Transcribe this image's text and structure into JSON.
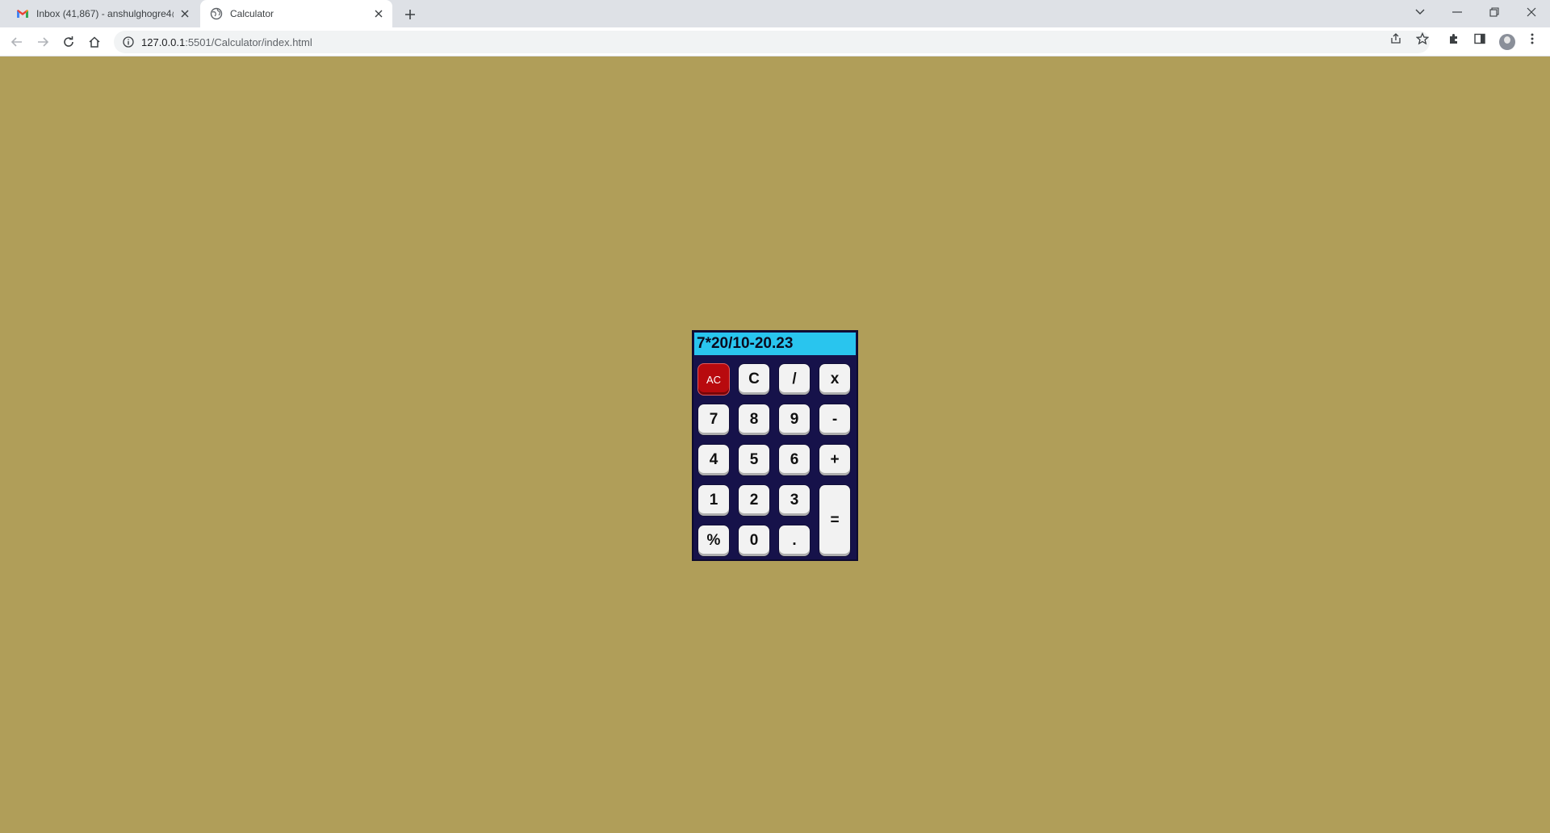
{
  "browser": {
    "tabs": [
      {
        "title": "Inbox (41,867) - anshulghogre4@",
        "icon": "gmail-icon",
        "active": false
      },
      {
        "title": "Calculator",
        "icon": "globe-icon",
        "active": true
      }
    ],
    "url": {
      "host": "127.0.0.1",
      "rest": ":5501/Calculator/index.html"
    }
  },
  "calculator": {
    "display": "7*20/10-20.23",
    "colors": {
      "page_bg": "#b09e59",
      "body_bg": "#16124a",
      "display_bg": "#29c5ee",
      "ac_bg": "#b80a0e",
      "key_bg": "#f2f2f2"
    },
    "keys": {
      "ac": "AC",
      "clear": "C",
      "divide": "/",
      "multiply": "x",
      "seven": "7",
      "eight": "8",
      "nine": "9",
      "minus": "-",
      "four": "4",
      "five": "5",
      "six": "6",
      "plus": "+",
      "one": "1",
      "two": "2",
      "three": "3",
      "equals": "=",
      "percent": "%",
      "zero": "0",
      "dot": "."
    }
  }
}
